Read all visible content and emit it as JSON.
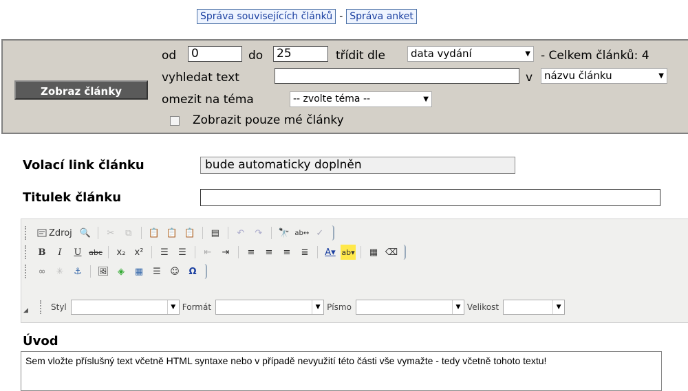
{
  "top_links": {
    "related": "Správa souvisejících článků",
    "separator": "-",
    "polls": "Správa anket"
  },
  "filter": {
    "show_button": "Zobraz články",
    "from_label": "od",
    "from_value": "0",
    "to_label": "do",
    "to_value": "25",
    "sort_label": "třídit dle",
    "sort_value": "data vydání",
    "total_label": "- Celkem článků: 4",
    "search_label": "vyhledat text",
    "search_value": "",
    "in_label": "v",
    "in_value": "názvu článku",
    "topic_label": "omezit na téma",
    "topic_value": "-- zvolte téma --",
    "mine_label": "Zobrazit pouze mé články"
  },
  "form": {
    "link_label": "Volací link článku",
    "link_value": "bude automaticky doplněn",
    "title_label": "Titulek článku",
    "title_value": ""
  },
  "editor": {
    "source_label": "Zdroj",
    "style_label": "Styl",
    "format_label": "Formát",
    "font_label": "Písmo",
    "size_label": "Velikost"
  },
  "intro": {
    "label": "Úvod",
    "text": "Sem vložte příslušný text včetně HTML syntaxe nebo v případě nevyužití této části vše vymažte - tedy včetně tohoto textu!"
  }
}
